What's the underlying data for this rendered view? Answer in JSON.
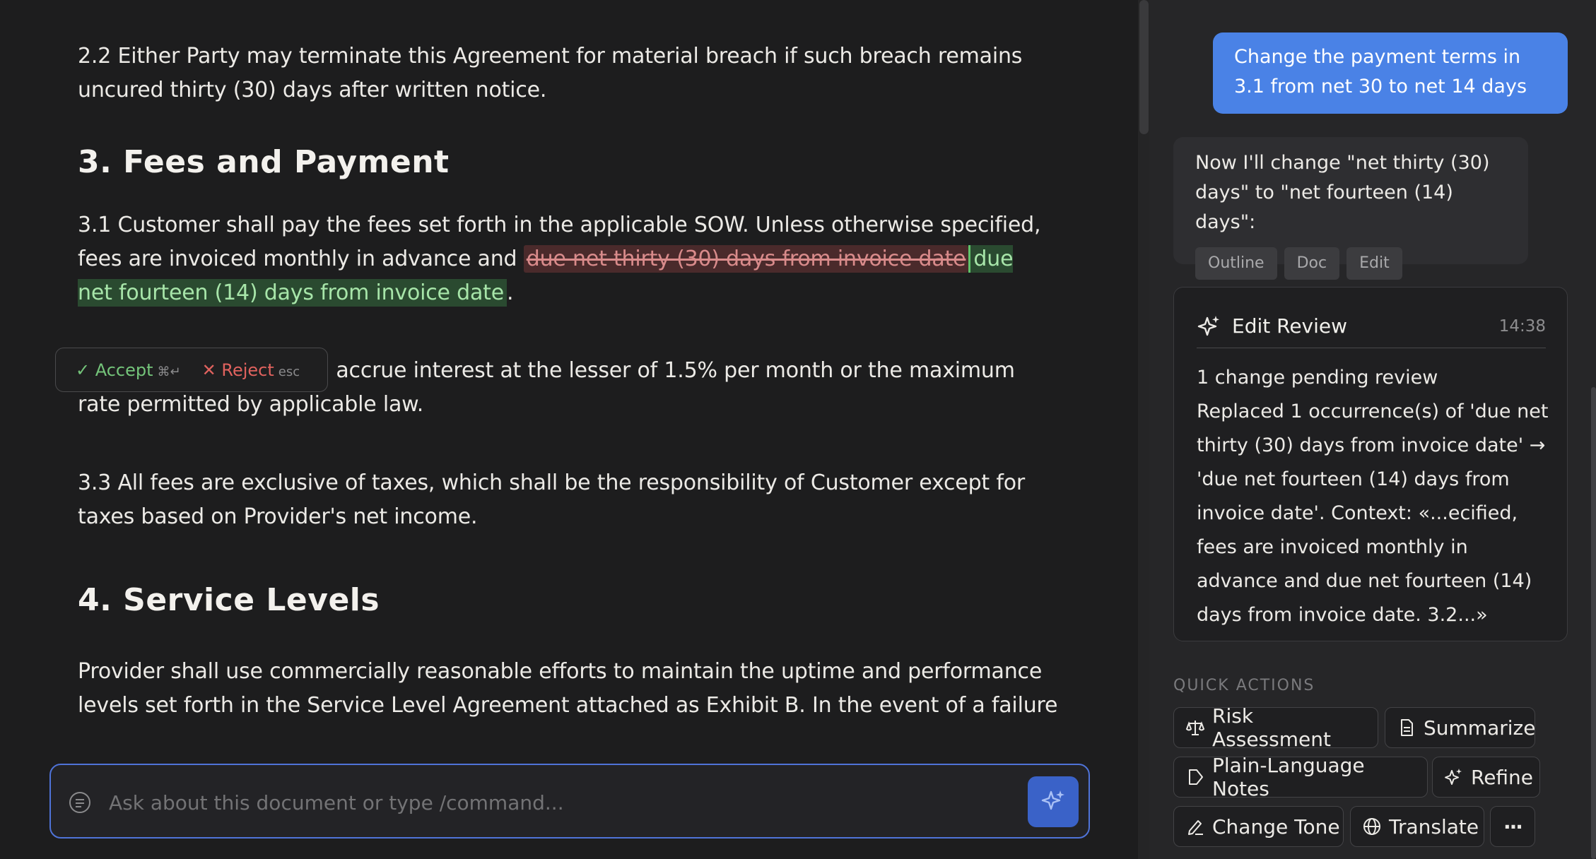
{
  "document": {
    "p22": "2.2 Either Party may terminate this Agreement for material breach if such breach remains uncured thirty (30) days after written notice.",
    "h3": "3. Fees and Payment",
    "p31_prefix": "3.1 Customer shall pay the fees set forth in the applicable SOW. Unless otherwise specified, fees are invoiced monthly in advance and ",
    "p31_deleted": "due net thirty (30) days from invoice date",
    "p31_inserted": "due net fourteen (14) days from invoice date",
    "p31_suffix": ".",
    "p32": "3.2 Late payments shall accrue interest at the lesser of 1.5% per month or the maximum rate permitted by applicable law.",
    "p33": "3.3 All fees are exclusive of taxes, which shall be the responsibility of Customer except for taxes based on Provider's net income.",
    "h4": "4. Service Levels",
    "p4": "Provider shall use commercially reasonable efforts to maintain the uptime and performance levels set forth in the Service Level Agreement attached as Exhibit B. In the event of a failure"
  },
  "accept_bar": {
    "accept_label": "✓ Accept",
    "accept_shortcut": "⌘↵",
    "reject_label": "✕ Reject",
    "reject_shortcut": "esc"
  },
  "chat_input": {
    "placeholder": "Ask about this document or type /command..."
  },
  "conversation": {
    "user_message": "Change the payment terms in 3.1 from net 30 to net 14 days",
    "assistant_message": "Now I'll change \"net thirty (30) days\" to \"net fourteen (14) days\":",
    "chips": [
      "Outline",
      "Doc",
      "Edit"
    ]
  },
  "edit_review": {
    "title": "Edit Review",
    "time": "14:38",
    "line1": "1 change pending review",
    "line2": "Replaced 1 occurrence(s) of 'due net thirty (30) days from invoice date' → 'due net fourteen (14) days from invoice date'. Context: «...ecified, fees are invoiced monthly in advance and due net fourteen (14) days from invoice date. 3.2...»"
  },
  "quick_actions": {
    "title": "QUICK ACTIONS",
    "risk": "Risk Assessment",
    "summarize": "Summarize",
    "notes": "Plain-Language Notes",
    "refine": "Refine",
    "tone": "Change Tone",
    "translate": "Translate",
    "more": "···"
  },
  "colors": {
    "accent": "#4a82e6",
    "insert_bg": "#2a4a30",
    "delete_bg": "#4a2a2b"
  }
}
